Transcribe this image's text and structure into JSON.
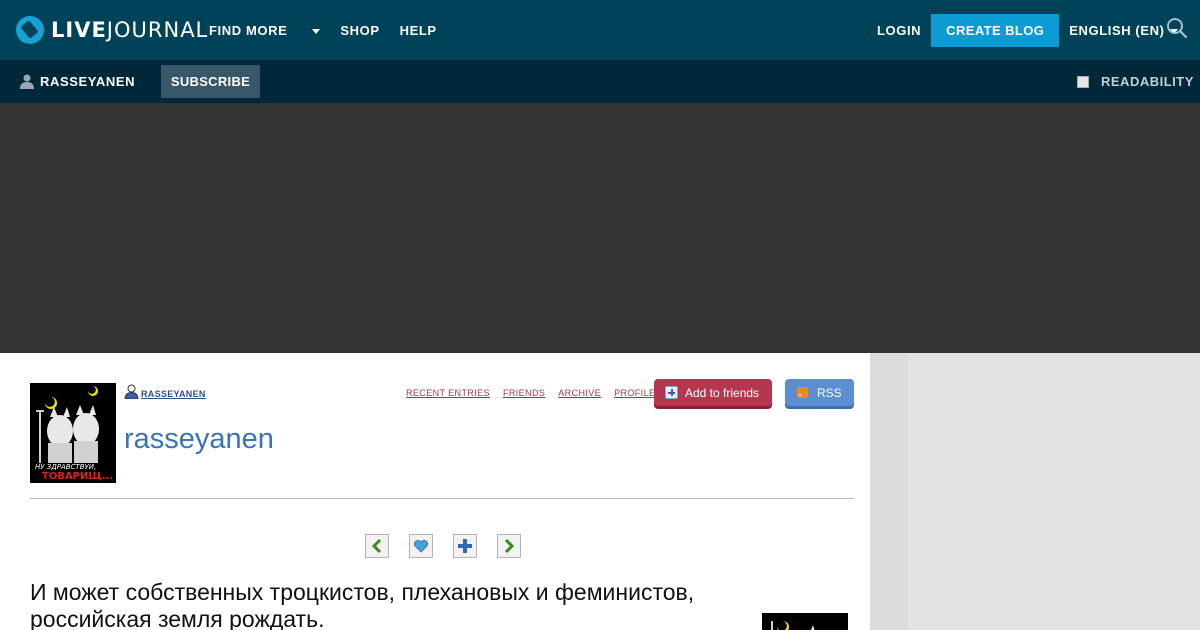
{
  "topbar": {
    "logo": {
      "prefix": "LIVE",
      "suffix": "JOURNAL"
    },
    "nav": [
      {
        "label": "FIND MORE",
        "dropdown": true
      },
      {
        "label": "SHOP"
      },
      {
        "label": "HELP"
      }
    ],
    "login": "LOGIN",
    "create_blog": "CREATE BLOG",
    "language": "ENGLISH (EN)",
    "colors": {
      "bar": "#004359",
      "accent": "#0d9bd4"
    }
  },
  "subbar": {
    "username": "RASSEYANEN",
    "subscribe": "SUBSCRIBE",
    "readability": "READABILITY"
  },
  "journal": {
    "small_username": "RASSEYANEN",
    "title": "rasseyanen",
    "links": [
      "RECENT ENTRIES",
      "FRIENDS",
      "ARCHIVE",
      "PROFILE"
    ],
    "add_friends": "Add to friends",
    "rss": "RSS",
    "userpic_text": {
      "line1": "НУ ЗДРАВСТВУЙ,",
      "line2": "ТОВАРИЩ..."
    }
  },
  "post": {
    "title": "И может собственных троцкистов, плехановых и феминистов, российская земля рождать."
  }
}
